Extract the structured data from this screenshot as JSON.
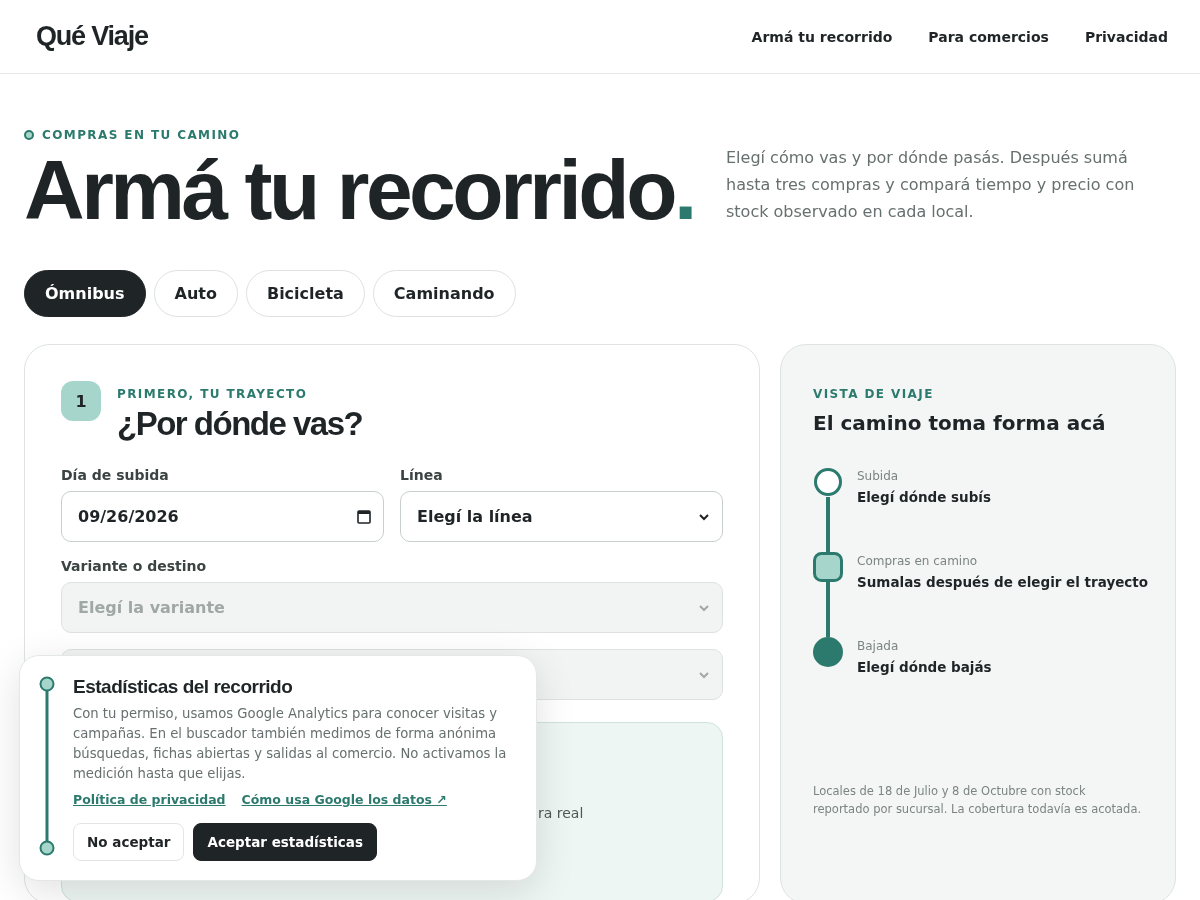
{
  "header": {
    "logo": "Qué Viaje",
    "nav": [
      "Armá tu recorrido",
      "Para comercios",
      "Privacidad"
    ]
  },
  "hero": {
    "eyebrow": "COMPRAS EN TU CAMINO",
    "title": "Armá tu recorrido.",
    "intro": "Elegí cómo vas y por dónde pasás. Después sumá hasta tres compras y compará tiempo y precio con stock observado en cada local."
  },
  "modes": [
    {
      "label": "Ómnibus",
      "selected": true
    },
    {
      "label": "Auto",
      "selected": false
    },
    {
      "label": "Bicicleta",
      "selected": false
    },
    {
      "label": "Caminando",
      "selected": false
    }
  ],
  "form": {
    "step": "1",
    "eyebrow": "PRIMERO, TU TRAYECTO",
    "title": "¿Por dónde vas?",
    "fields": [
      {
        "label": "Día de subida",
        "kind": "date",
        "value": "09/26/2026",
        "disabled": false
      },
      {
        "label": "Línea",
        "kind": "select",
        "value": "Elegí la línea",
        "disabled": false
      },
      {
        "label": "Variante o destino",
        "kind": "select",
        "placeholder": "Elegí la variante",
        "disabled": true
      },
      {
        "kind": "select",
        "disabled": true
      }
    ],
    "note_fragment": "ra real"
  },
  "preview": {
    "eyebrow": "VISTA DE VIAJE",
    "title": "El camino toma forma acá",
    "stops": [
      {
        "kind": "ring",
        "caption": "Subida",
        "text": "Elegí dónde subís"
      },
      {
        "kind": "square",
        "caption": "Compras en camino",
        "text": "Sumalas después de elegir el trayecto"
      },
      {
        "kind": "dot",
        "caption": "Bajada",
        "text": "Elegí dónde bajás"
      }
    ],
    "footnote": "Locales de 18 de Julio y 8 de Octubre con stock reportado por sucursal. La cobertura todavía es acotada."
  },
  "consent": {
    "title": "Estadísticas del recorrido",
    "body": "Con tu permiso, usamos Google Analytics para conocer visitas y campañas. En el buscador también medimos de forma anónima búsquedas, fichas abiertas y salidas al comercio. No activamos la medición hasta que elijas.",
    "links": [
      "Política de privacidad",
      "Cómo usa Google los datos ↗"
    ],
    "buttons": [
      {
        "label": "No aceptar",
        "kind": "secondary"
      },
      {
        "label": "Aceptar estadísticas",
        "kind": "primary"
      }
    ]
  }
}
